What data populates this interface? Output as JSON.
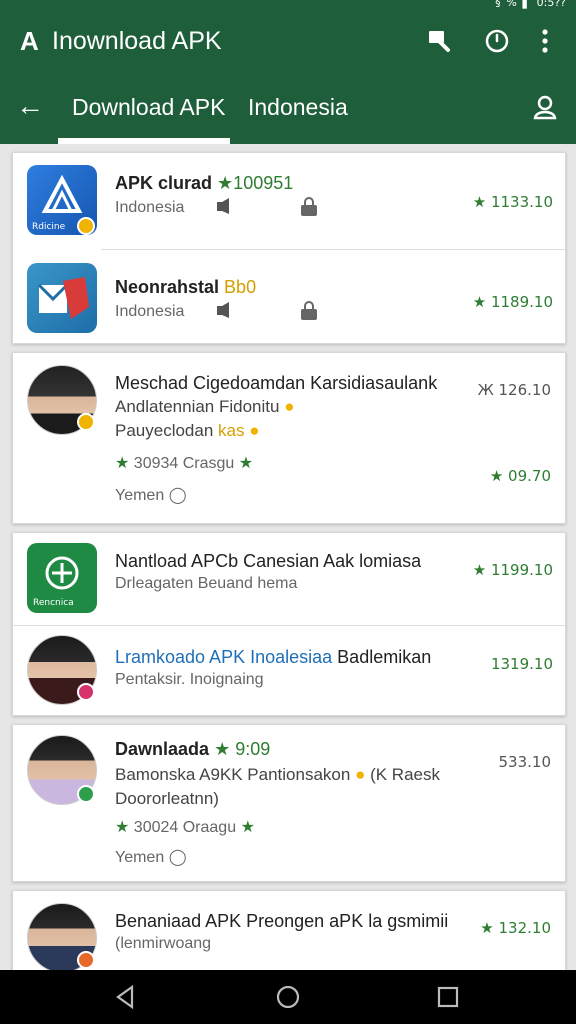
{
  "status": {
    "text": "§  %  ▌  0:5??"
  },
  "appbar": {
    "logo": "A",
    "title": "Inownload APK"
  },
  "tabs": {
    "tab1": "Download APK",
    "tab2": "Indonesia"
  },
  "colors": {
    "primary": "#1f5e3a",
    "accent": "#2e7d32",
    "gold": "#d4a000"
  },
  "cards": {
    "c1": {
      "r1": {
        "name": "APK clurad",
        "rating": "★100951",
        "sub": "Indonesia",
        "price": "★ 1133.10",
        "icon_text": "Rdicine"
      },
      "r2": {
        "name": "Neonrahstal",
        "tag": "Bb0",
        "sub": "Indonesia",
        "price": "★ 1189.10"
      }
    },
    "c2": {
      "line1": "Meschad Cigedoamdan Karsidiasaulank",
      "line2a": "Andlatennian Fidonitu",
      "line3a": "Pauyeclodan",
      "line3b": "kas",
      "stars": "30934 Crasgu",
      "foot": "Yemen",
      "price1": "Ж 126.10",
      "price2": "★ 09.70"
    },
    "c3": {
      "r1": {
        "name": "Nantload APCb Canesian Aak lomiasa",
        "sub": "Drleagaten Beuand hema",
        "price": "★ 1199.10",
        "icon_text": "Rencnica"
      },
      "r2": {
        "name": "Lramkoado APK Inoalesiaa",
        "name2": "Badlemikan",
        "sub": "Pentaksir. Inoignaing",
        "price": "1319.10"
      }
    },
    "c4": {
      "name": "Dawnlaada",
      "rating": "★ 9:09",
      "line2": "Bamonska A9KK Pantionsakon",
      "line2b": "(K Raesk",
      "line3": "Doororleatnn)",
      "stars": "30024 Oraagu",
      "foot": "Yemen",
      "price": "533.10"
    },
    "c5": {
      "name": "Benaniaad APK Preongen aPK la gsmimii",
      "sub": "(lenmirwoang",
      "price": "★ 132.10"
    }
  }
}
